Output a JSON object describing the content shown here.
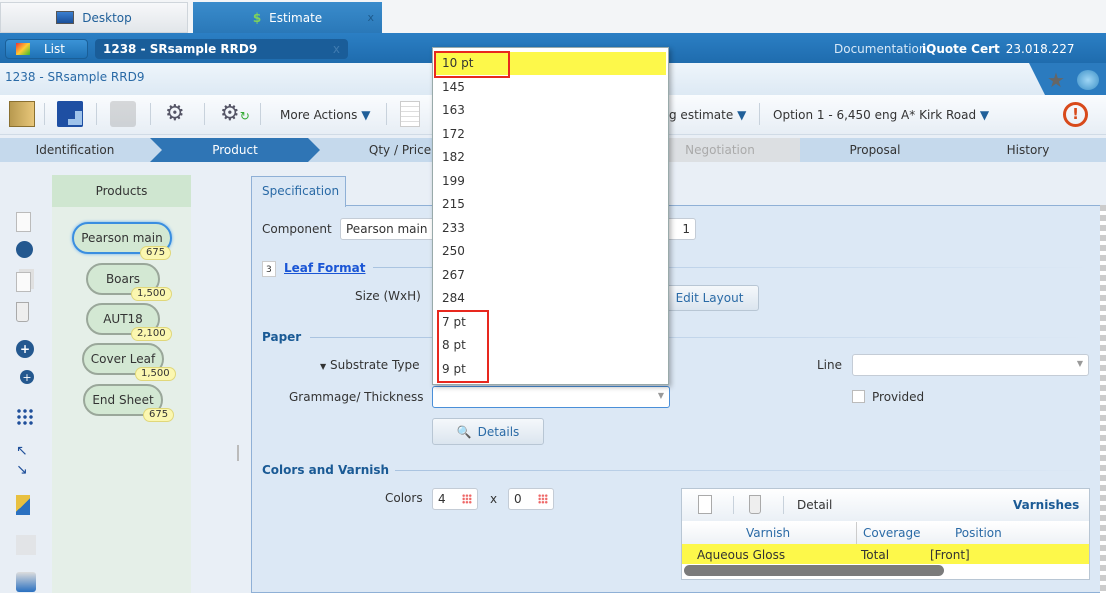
{
  "tabs": {
    "desktop": "Desktop",
    "estimate": "Estimate",
    "close": "x"
  },
  "header": {
    "list_label": "List",
    "document_tab": "1238 - SRsample RRD9",
    "close": "x",
    "documentation": "Documentation",
    "app_name": "iQuote Cert",
    "version": "23.018.227"
  },
  "breadcrumb": "1238 - SRsample RRD9",
  "toolbar": {
    "more_actions": "More Actions",
    "estimate_menu": "g estimate",
    "option_menu": "Option 1 - 6,450 eng A* Kirk Road"
  },
  "steps": [
    "Identification",
    "Product",
    "Qty / Price",
    "Negotiation",
    "Proposal",
    "History"
  ],
  "products": {
    "header": "Products",
    "items": [
      {
        "name": "Pearson main",
        "qty": "675",
        "selected": true
      },
      {
        "name": "Boars",
        "qty": "1,500"
      },
      {
        "name": "AUT18",
        "qty": "2,100"
      },
      {
        "name": "Cover Leaf",
        "qty": "1,500"
      },
      {
        "name": "End Sheet",
        "qty": "675"
      }
    ]
  },
  "spec": {
    "tab": "Specification",
    "component_label": "Component",
    "component_value": "Pearson main",
    "component_count": "1",
    "leaf_format": "Leaf Format",
    "leaf_icon_number": "3",
    "size_label": "Size (WxH)",
    "edit_layout": "Edit Layout",
    "paper": "Paper",
    "substrate_label": "Substrate Type",
    "line_label": "Line",
    "grammage_label": "Grammage/ Thickness",
    "provided_label": "Provided",
    "details": "Details",
    "colors_varnish": "Colors and Varnish",
    "colors_label": "Colors",
    "colors_front": "4",
    "colors_x": "x",
    "colors_back": "0"
  },
  "dropdown": {
    "options": [
      "10 pt",
      "145",
      "163",
      "172",
      "182",
      "199",
      "215",
      "233",
      "250",
      "267",
      "284",
      "7 pt",
      "8 pt",
      "9 pt"
    ],
    "highlighted": "10 pt"
  },
  "varnish": {
    "detail": "Detail",
    "title": "Varnishes",
    "columns": [
      "Varnish",
      "Coverage",
      "Position"
    ],
    "rows": [
      {
        "varnish": "Aqueous Gloss",
        "coverage": "Total",
        "position": "[Front]"
      }
    ]
  },
  "colors": {
    "accent": "#2f75b5",
    "highlight": "#fdf84a",
    "annotation": "#e8281e"
  }
}
